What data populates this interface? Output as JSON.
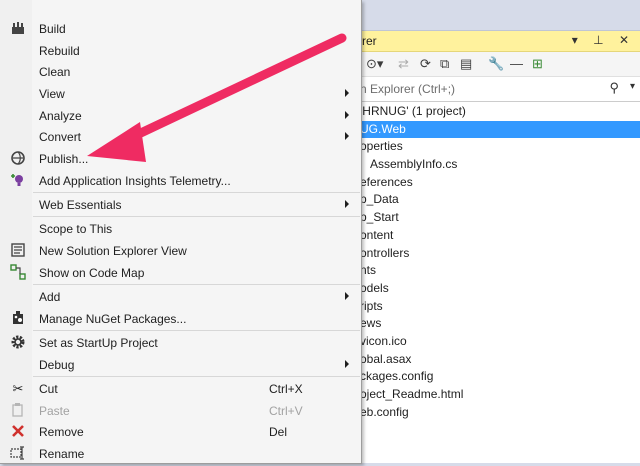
{
  "colors": {
    "annotation_arrow": "#ef2b62",
    "selection": "#3399ff",
    "se_title_bg": "#fff29d"
  },
  "solution_explorer": {
    "title_partial": "rer",
    "title_icons": "▾ ⊥ ✕",
    "search_placeholder": "n Explorer (Ctrl+;)",
    "tree": [
      {
        "text": "'HRNUG' (1 project)",
        "selected": false
      },
      {
        "text": "UG.Web",
        "selected": true
      },
      {
        "text": "operties",
        "selected": false
      },
      {
        "text": "AssemblyInfo.cs",
        "selected": false
      },
      {
        "text": "eferences",
        "selected": false
      },
      {
        "text": "p_Data",
        "selected": false
      },
      {
        "text": "p_Start",
        "selected": false
      },
      {
        "text": "ontent",
        "selected": false
      },
      {
        "text": "ontrollers",
        "selected": false
      },
      {
        "text": "nts",
        "selected": false
      },
      {
        "text": "odels",
        "selected": false
      },
      {
        "text": "ripts",
        "selected": false
      },
      {
        "text": "ews",
        "selected": false
      },
      {
        "text": "vicon.ico",
        "selected": false
      },
      {
        "text": "obal.asax",
        "selected": false
      },
      {
        "text": "ckages.config",
        "selected": false
      },
      {
        "text": "oject_Readme.html",
        "selected": false
      },
      {
        "text": "eb.config",
        "selected": false
      }
    ]
  },
  "menu": {
    "items": [
      {
        "label": "Build",
        "icon": "build-icon"
      },
      {
        "label": "Rebuild"
      },
      {
        "label": "Clean"
      },
      {
        "label": "View",
        "submenu": true
      },
      {
        "label": "Analyze",
        "submenu": true
      },
      {
        "label": "Convert",
        "submenu": true
      },
      {
        "label": "Publish...",
        "icon": "publish-icon"
      },
      {
        "label": "Add Application Insights Telemetry...",
        "icon": "insights-icon"
      },
      {
        "label": "Web Essentials",
        "submenu": true
      },
      {
        "label": "Scope to This"
      },
      {
        "label": "New Solution Explorer View",
        "icon": "new-explorer-view-icon"
      },
      {
        "label": "Show on Code Map",
        "icon": "code-map-icon"
      },
      {
        "label": "Add",
        "submenu": true
      },
      {
        "label": "Manage NuGet Packages...",
        "icon": "nuget-icon"
      },
      {
        "label": "Set as StartUp Project",
        "icon": "gear-icon"
      },
      {
        "label": "Debug",
        "submenu": true
      },
      {
        "label": "Cut",
        "shortcut": "Ctrl+X",
        "icon": "scissors-icon"
      },
      {
        "label": "Paste",
        "shortcut": "Ctrl+V",
        "icon": "paste-icon",
        "disabled": true
      },
      {
        "label": "Remove",
        "shortcut": "Del",
        "icon": "remove-icon"
      },
      {
        "label": "Rename",
        "icon": "rename-icon"
      }
    ]
  }
}
